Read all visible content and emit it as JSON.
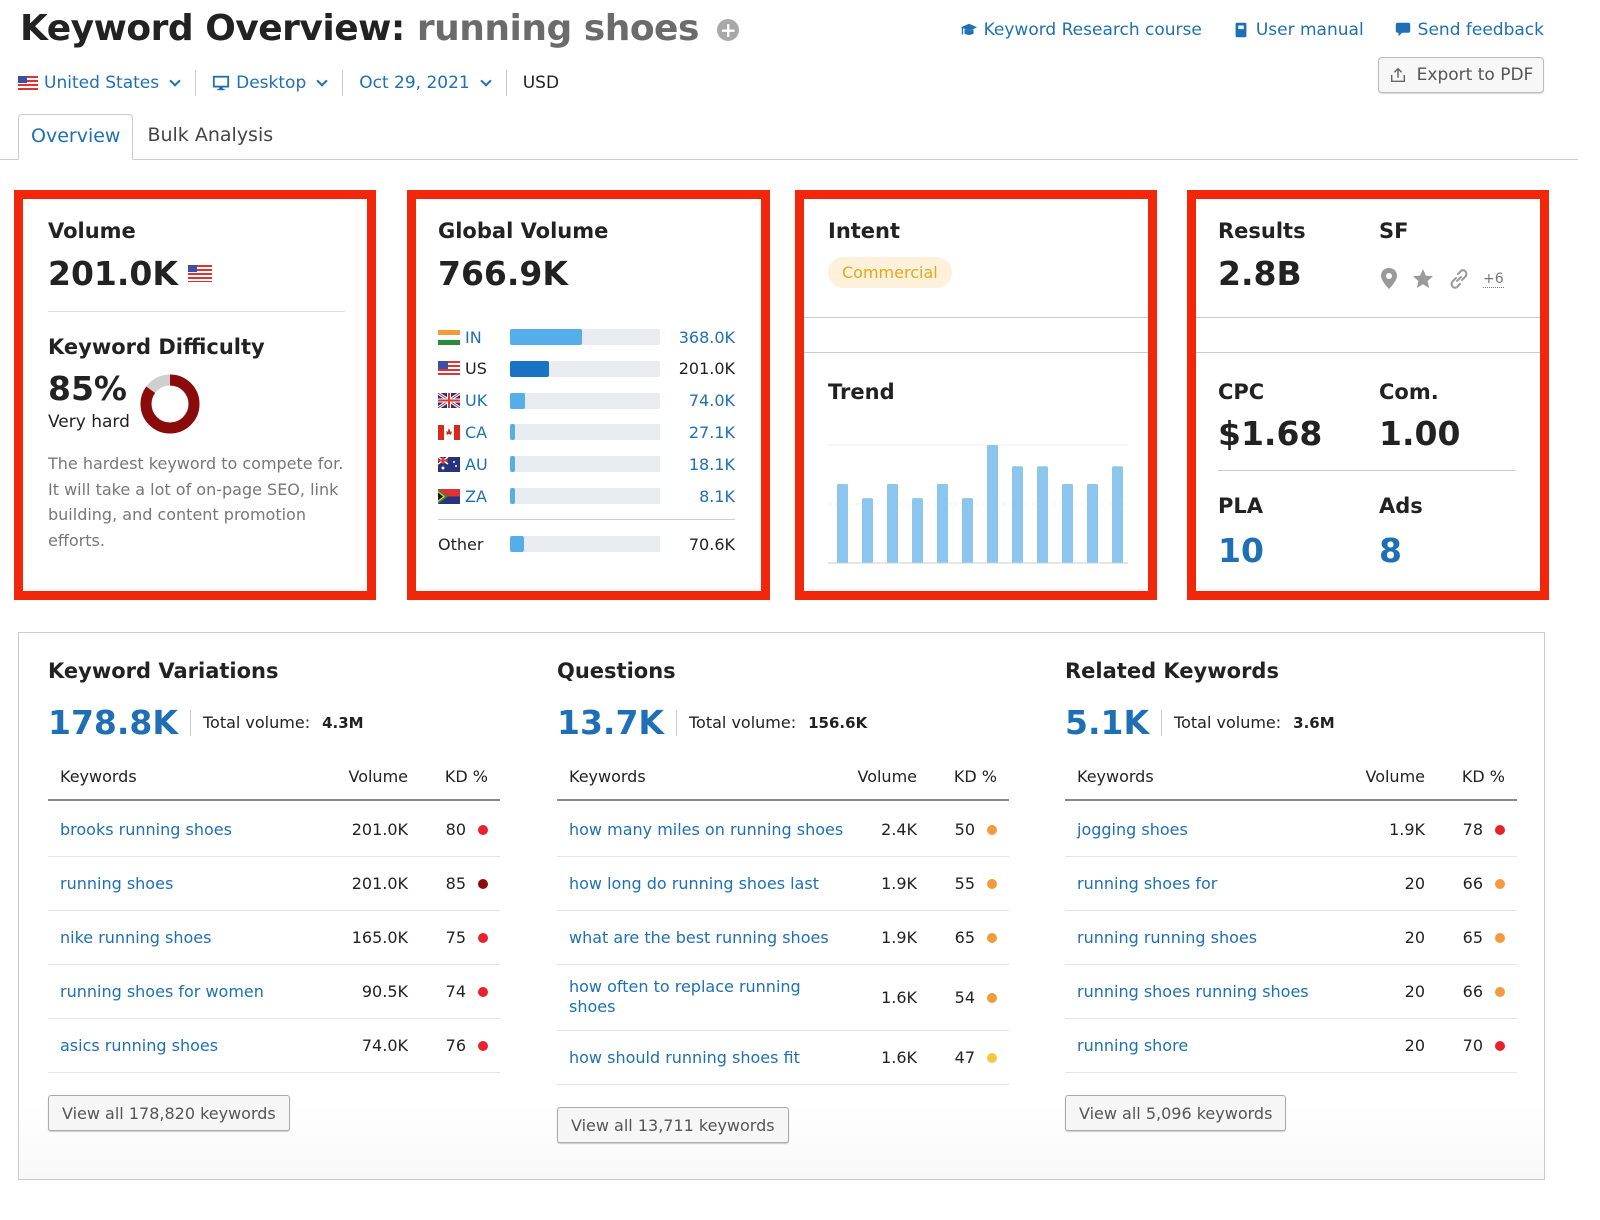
{
  "header": {
    "title_prefix": "Keyword Overview:",
    "keyword": "running shoes",
    "add_icon": "plus-circle-icon",
    "links": [
      {
        "label": "Keyword Research course",
        "icon": "graduation-cap-icon"
      },
      {
        "label": "User manual",
        "icon": "book-icon"
      },
      {
        "label": "Send feedback",
        "icon": "speech-bubble-icon"
      }
    ],
    "export_label": "Export to PDF"
  },
  "filters": {
    "country": "United States",
    "device": "Desktop",
    "date": "Oct 29, 2021",
    "currency": "USD"
  },
  "tabs": [
    {
      "label": "Overview",
      "active": true
    },
    {
      "label": "Bulk Analysis",
      "active": false
    }
  ],
  "volume_card": {
    "volume_label": "Volume",
    "volume_value": "201.0K",
    "kd_label": "Keyword Difficulty",
    "kd_value": "85%",
    "kd_percent": 85,
    "kd_level": "Very hard",
    "kd_description": "The hardest keyword to compete for. It will take a lot of on-page SEO, link building, and content promotion efforts.",
    "kd_color": "#8b0a0a"
  },
  "global_volume": {
    "label": "Global Volume",
    "value": "766.9K",
    "countries": [
      {
        "code": "IN",
        "value": "368.0K",
        "share": 0.48
      },
      {
        "code": "US",
        "value": "201.0K",
        "share": 0.26
      },
      {
        "code": "UK",
        "value": "74.0K",
        "share": 0.1
      },
      {
        "code": "CA",
        "value": "27.1K",
        "share": 0.035
      },
      {
        "code": "AU",
        "value": "18.1K",
        "share": 0.024
      },
      {
        "code": "ZA",
        "value": "8.1K",
        "share": 0.011
      }
    ],
    "other": {
      "label": "Other",
      "value": "70.6K",
      "share": 0.092
    }
  },
  "intent_card": {
    "intent_label": "Intent",
    "intent_value": "Commercial",
    "trend_label": "Trend",
    "trend_values": [
      67,
      55,
      67,
      55,
      67,
      55,
      100,
      82,
      82,
      67,
      67,
      82
    ]
  },
  "results_card": {
    "results_label": "Results",
    "results_value": "2.8B",
    "sf_label": "SF",
    "sf_icons": [
      "map-pin-icon",
      "star-icon",
      "link-icon"
    ],
    "sf_more": "+6",
    "cpc_label": "CPC",
    "cpc_value": "$1.68",
    "com_label": "Com.",
    "com_value": "1.00",
    "pla_label": "PLA",
    "pla_value": "10",
    "ads_label": "Ads",
    "ads_value": "8"
  },
  "sections": [
    {
      "title": "Keyword Variations",
      "count": "178.8K",
      "total_label": "Total volume:",
      "total_value": "4.3M",
      "headers": [
        "Keywords",
        "Volume",
        "KD %"
      ],
      "rows": [
        {
          "keyword": "brooks running shoes",
          "volume": "201.0K",
          "kd": "80",
          "color": "#e8222a"
        },
        {
          "keyword": "running shoes",
          "volume": "201.0K",
          "kd": "85",
          "color": "#8b0a0a"
        },
        {
          "keyword": "nike running shoes",
          "volume": "165.0K",
          "kd": "75",
          "color": "#e8222a"
        },
        {
          "keyword": "running shoes for women",
          "volume": "90.5K",
          "kd": "74",
          "color": "#e8222a"
        },
        {
          "keyword": "asics running shoes",
          "volume": "74.0K",
          "kd": "76",
          "color": "#e8222a"
        }
      ],
      "view_all": "View all 178,820 keywords"
    },
    {
      "title": "Questions",
      "count": "13.7K",
      "total_label": "Total volume:",
      "total_value": "156.6K",
      "headers": [
        "Keywords",
        "Volume",
        "KD %"
      ],
      "rows": [
        {
          "keyword": "how many miles on running shoes",
          "volume": "2.4K",
          "kd": "50",
          "color": "#f39a3c"
        },
        {
          "keyword": "how long do running shoes last",
          "volume": "1.9K",
          "kd": "55",
          "color": "#f39a3c"
        },
        {
          "keyword": "what are the best running shoes",
          "volume": "1.9K",
          "kd": "65",
          "color": "#f39a3c"
        },
        {
          "keyword": "how often to replace running shoes",
          "volume": "1.6K",
          "kd": "54",
          "color": "#f39a3c"
        },
        {
          "keyword": "how should running shoes fit",
          "volume": "1.6K",
          "kd": "47",
          "color": "#f5c842"
        }
      ],
      "view_all": "View all 13,711 keywords"
    },
    {
      "title": "Related Keywords",
      "count": "5.1K",
      "total_label": "Total volume:",
      "total_value": "3.6M",
      "headers": [
        "Keywords",
        "Volume",
        "KD %"
      ],
      "rows": [
        {
          "keyword": "jogging shoes",
          "volume": "1.9K",
          "kd": "78",
          "color": "#e8222a"
        },
        {
          "keyword": "running shoes for",
          "volume": "20",
          "kd": "66",
          "color": "#f39a3c"
        },
        {
          "keyword": "running running shoes",
          "volume": "20",
          "kd": "65",
          "color": "#f39a3c"
        },
        {
          "keyword": "running shoes running shoes",
          "volume": "20",
          "kd": "66",
          "color": "#f39a3c"
        },
        {
          "keyword": "running shore",
          "volume": "20",
          "kd": "70",
          "color": "#e8222a"
        }
      ],
      "view_all": "View all 5,096 keywords"
    }
  ]
}
